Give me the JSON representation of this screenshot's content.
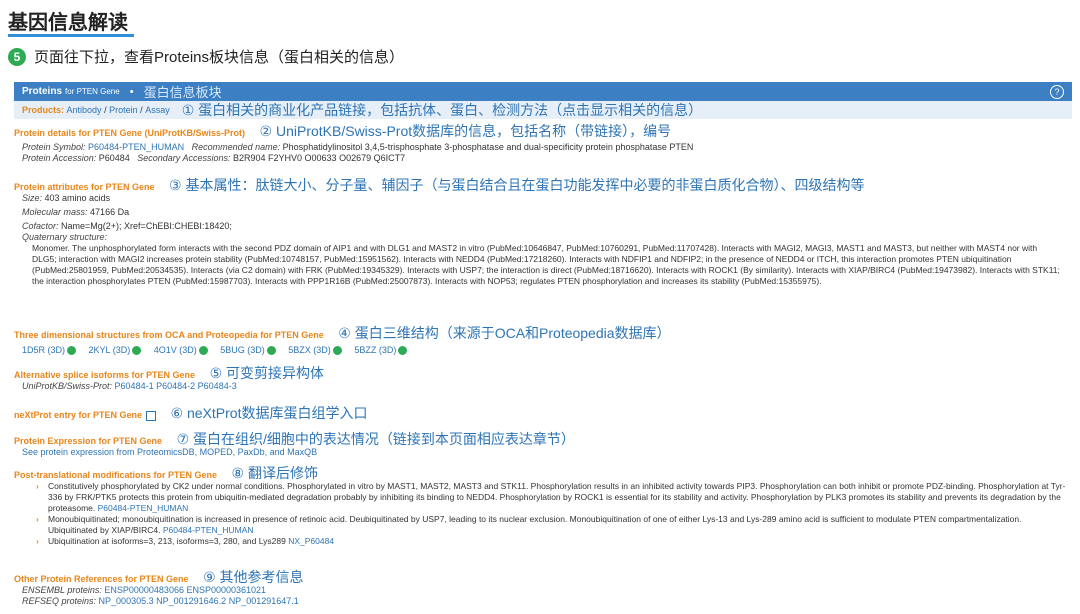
{
  "page_title": "基因信息解读",
  "step": {
    "num": "5",
    "text": "页面往下拉，查看Proteins板块信息（蛋白相关的信息）"
  },
  "header": {
    "title": "Proteins",
    "subtitle": "for PTEN Gene",
    "dot": "•",
    "note": "蛋白信息板块",
    "help": "?"
  },
  "products": {
    "label": "Products:",
    "items": [
      "Antibody",
      "Protein",
      "Assay"
    ],
    "sep": "/",
    "note": "① 蛋白相关的商业化产品链接，包括抗体、蛋白、检测方法（点击显示相关的信息）"
  },
  "details": {
    "title": "Protein details for PTEN Gene (UniProtKB/Swiss-Prot)",
    "note": "② UniProtKB/Swiss-Prot数据库的信息，包括名称（带链接），编号",
    "symbol_label": "Protein Symbol:",
    "symbol": "P60484-PTEN_HUMAN",
    "rec_label": "Recommended name:",
    "rec": "Phosphatidylinositol 3,4,5-trisphosphate 3-phosphatase and dual-specificity protein phosphatase PTEN",
    "acc_label": "Protein Accession:",
    "acc": "P60484",
    "sec_label": "Secondary Accessions:",
    "sec": "B2R904 F2YHV0 O00633 O02679 Q6ICT7"
  },
  "attributes": {
    "title": "Protein attributes for PTEN Gene",
    "note": "③ 基本属性：肽链大小、分子量、辅因子（与蛋白结合且在蛋白功能发挥中必要的非蛋白质化合物）、四级结构等",
    "size_label": "Size:",
    "size": "403 amino acids",
    "mass_label": "Molecular mass:",
    "mass": "47166 Da",
    "cof_label": "Cofactor:",
    "cof": "Name=Mg(2+); Xref=ChEBI:CHEBI:18420;",
    "quat_label": "Quaternary structure:",
    "quat": "Monomer. The unphosphorylated form interacts with the second PDZ domain of AIP1 and with DLG1 and MAST2 in vitro (PubMed:10646847, PubMed:10760291, PubMed:11707428). Interacts with MAGI2, MAGI3, MAST1 and MAST3, but neither with MAST4 nor with DLG5; interaction with MAGI2 increases protein stability (PubMed:10748157, PubMed:15951562). Interacts with NEDD4 (PubMed:17218260). Interacts with NDFIP1 and NDFIP2; in the presence of NEDD4 or ITCH, this interaction promotes PTEN ubiquitination (PubMed:25801959, PubMed:20534535). Interacts (via C2 domain) with FRK (PubMed:19345329). Interacts with USP7; the interaction is direct (PubMed:18716620). Interacts with ROCK1 (By similarity). Interacts with XIAP/BIRC4 (PubMed:19473982). Interacts with STK11; the interaction phosphorylates PTEN (PubMed:15987703). Interacts with PPP1R16B (PubMed:25007873). Interacts with NOP53; regulates PTEN phosphorylation and increases its stability (PubMed:15355975)."
  },
  "structures": {
    "title": "Three dimensional structures from OCA and Proteopedia for PTEN Gene",
    "note": "④ 蛋白三维结构（来源于OCA和Proteopedia数据库）",
    "items": [
      "1D5R (3D)",
      "2KYL (3D)",
      "4O1V (3D)",
      "5BUG (3D)",
      "5BZX (3D)",
      "5BZZ (3D)"
    ]
  },
  "isoforms": {
    "title": "Alternative splice isoforms for PTEN Gene",
    "note": "⑤ 可变剪接异构体",
    "label": "UniProtKB/Swiss-Prot:",
    "items": [
      "P60484-1",
      "P60484-2",
      "P60484-3"
    ]
  },
  "nextprot": {
    "title": "neXtProt entry for PTEN Gene",
    "note": "⑥ neXtProt数据库蛋白组学入口"
  },
  "expression": {
    "title": "Protein Expression for PTEN Gene",
    "note": "⑦ 蛋白在组织/细胞中的表达情况（链接到本页面相应表达章节）",
    "link": "See protein expression from ProteomicsDB, MOPED, PaxDb, and MaxQB"
  },
  "ptm": {
    "title": "Post-translational modifications for PTEN Gene",
    "note": "⑧ 翻译后修饰",
    "b1": "Constitutively phosphorylated by CK2 under normal conditions. Phosphorylated in vitro by MAST1, MAST2, MAST3 and STK11. Phosphorylation results in an inhibited activity towards PIP3. Phosphorylation can both inhibit or promote PDZ-binding. Phosphorylation at Tyr-336 by FRK/PTK5 protects this protein from ubiquitin-mediated degradation probably by inhibiting its binding to NEDD4. Phosphorylation by ROCK1 is essential for its stability and activity. Phosphorylation by PLK3 promotes its stability and prevents its degradation by the proteasome.",
    "b1_link": "P60484-PTEN_HUMAN",
    "b2": "Monoubiquitinated; monoubiquitination is increased in presence of retinoic acid. Deubiquitinated by USP7, leading to its nuclear exclusion. Monoubiquitination of one of either Lys-13 and Lys-289 amino acid is sufficient to modulate PTEN compartmentalization. Ubiquitinated by XIAP/BIRC4.",
    "b2_link": "P60484-PTEN_HUMAN",
    "b3": "Ubiquitination at isoforms=3, 213, isoforms=3, 280, and Lys289",
    "b3_link": "NX_P60484"
  },
  "other": {
    "title": "Other Protein References for PTEN Gene",
    "note": "⑨ 其他参考信息",
    "ens_label": "ENSEMBL proteins:",
    "ens": [
      "ENSP00000483066",
      "ENSP00000361021"
    ],
    "ref_label": "REFSEQ proteins:",
    "ref": [
      "NP_000305.3",
      "NP_001291646.2",
      "NP_001291647.1"
    ]
  }
}
